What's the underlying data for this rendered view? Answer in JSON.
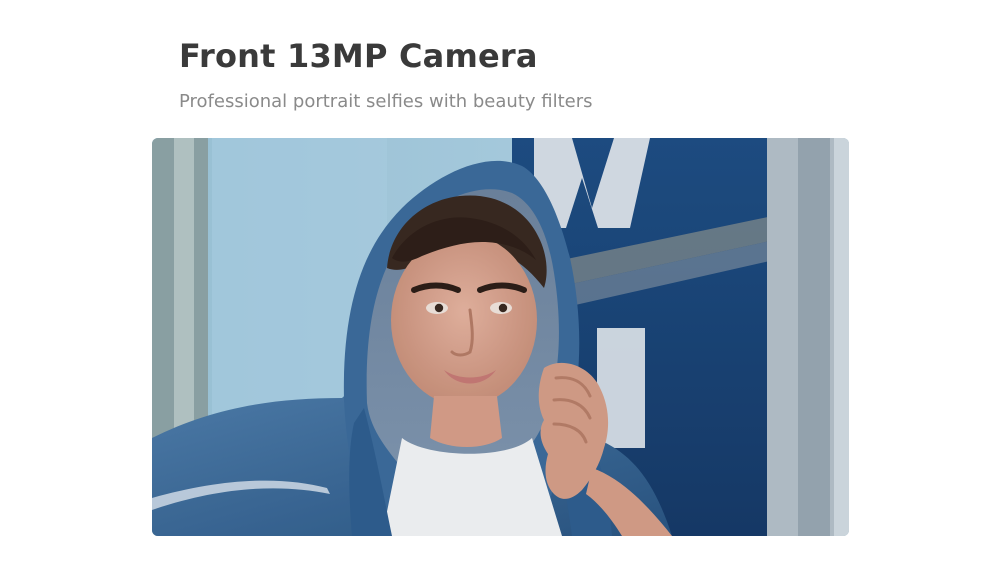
{
  "header": {
    "title": "Front 13MP Camera",
    "subtitle": "Professional portrait selfies with beauty filters"
  },
  "colors": {
    "title": "#3a3a3a",
    "subtitle": "#8a8a8a",
    "background": "#ffffff"
  }
}
